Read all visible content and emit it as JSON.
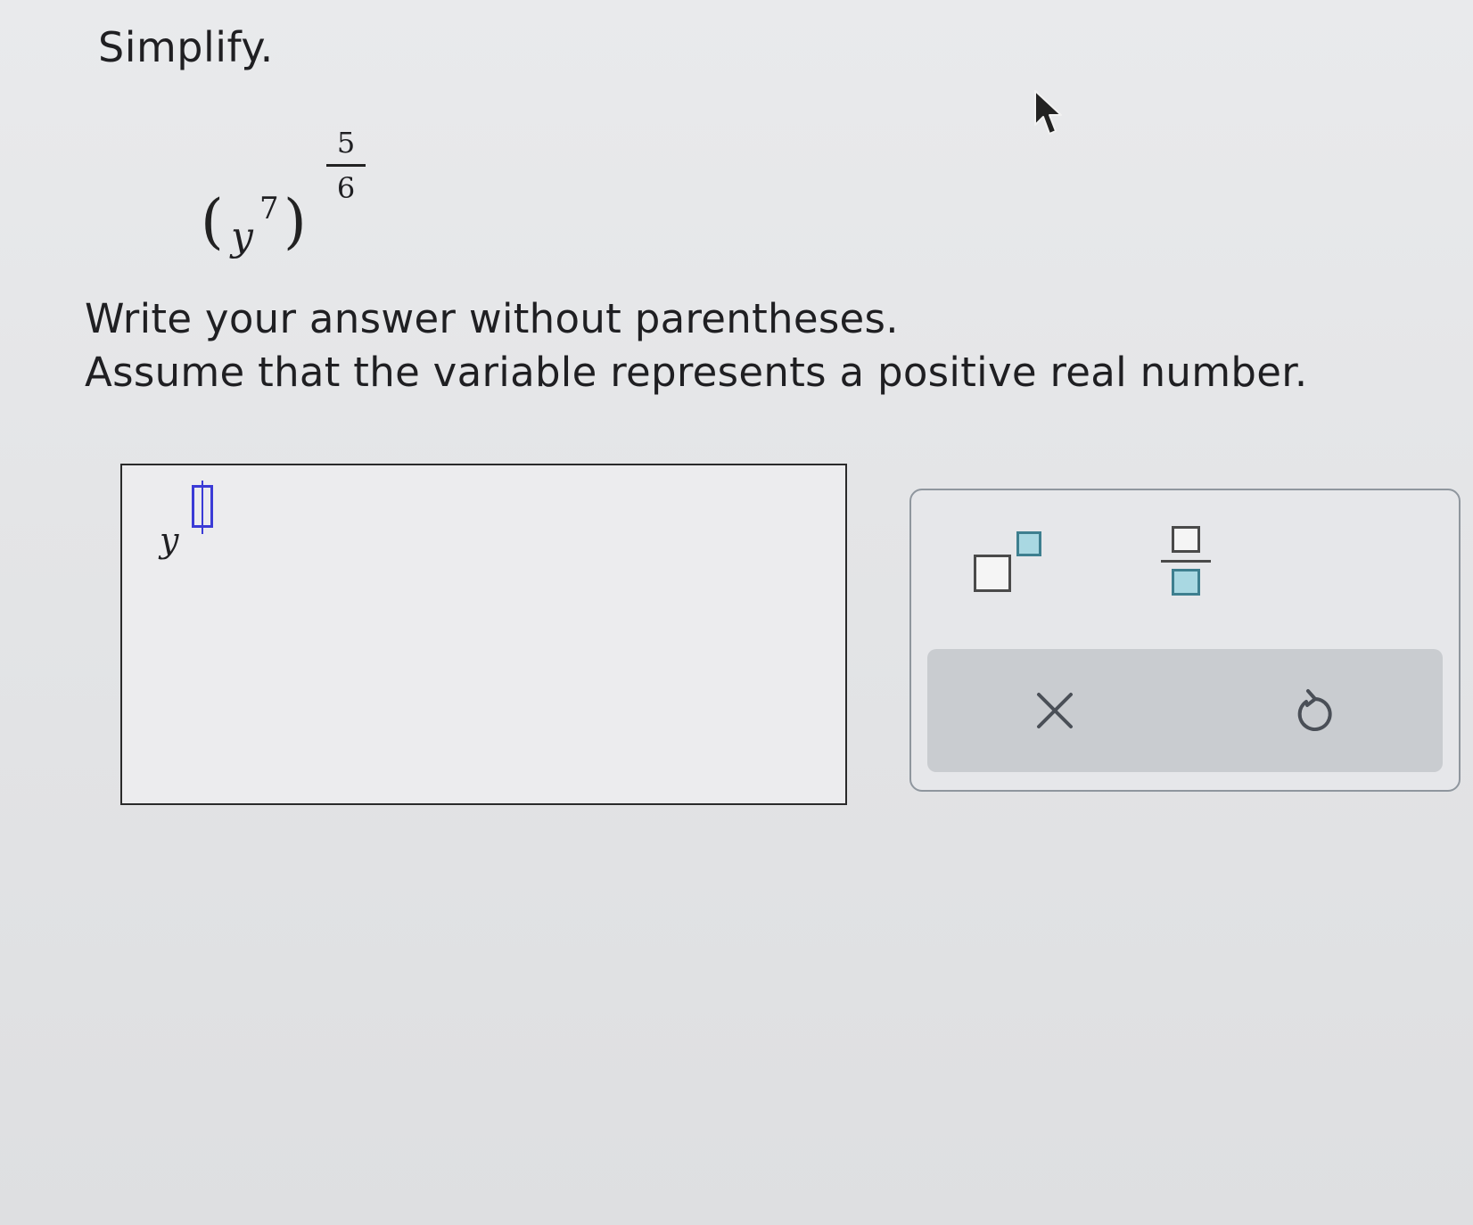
{
  "question": {
    "title": "Simplify.",
    "expression": {
      "base": "y",
      "inner_exponent": "7",
      "outer_exponent_numerator": "5",
      "outer_exponent_denominator": "6"
    },
    "directions": [
      "Write your answer without parentheses.",
      "Assume that the variable represents a positive real number."
    ]
  },
  "answer": {
    "base": "y"
  },
  "keypad": {
    "keys": [
      {
        "name": "exponent-key",
        "icon": "superscript-template-icon"
      },
      {
        "name": "fraction-key",
        "icon": "fraction-template-icon"
      }
    ],
    "actions": [
      {
        "name": "clear-button",
        "icon": "close-icon"
      },
      {
        "name": "undo-button",
        "icon": "undo-icon"
      }
    ]
  },
  "colors": {
    "slot_highlight": "#3b3bd6",
    "template_accent": "#a9d8e2",
    "action_bar": "#c9ccd0"
  }
}
